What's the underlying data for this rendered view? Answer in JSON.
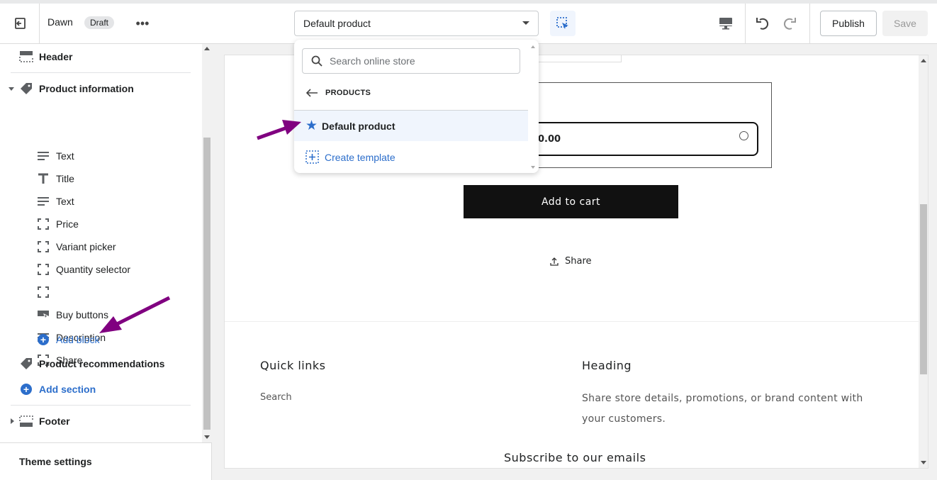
{
  "topbar": {
    "theme_name": "Dawn",
    "status_badge": "Draft",
    "template_select": "Default product",
    "publish_label": "Publish",
    "save_label": "Save"
  },
  "dropdown": {
    "search_placeholder": "Search online store",
    "back_label": "PRODUCTS",
    "selected_item": "Default product",
    "create_label": "Create template"
  },
  "sidebar": {
    "header": "Header",
    "product_information": "Product information",
    "blocks": [
      {
        "label": "Text",
        "icon": "text-icon"
      },
      {
        "label": "Title",
        "icon": "title-icon"
      },
      {
        "label": "Text",
        "icon": "text-icon"
      },
      {
        "label": "Price",
        "icon": "block-icon"
      },
      {
        "label": "Variant picker",
        "icon": "block-icon"
      },
      {
        "label": "Quantity selector",
        "icon": "block-icon"
      },
      {
        "label": "",
        "icon": "block-icon"
      },
      {
        "label": "Buy buttons",
        "icon": "buy-buttons-icon"
      },
      {
        "label": "Description",
        "icon": "text-icon"
      },
      {
        "label": "Share",
        "icon": "block-icon"
      }
    ],
    "add_block": "Add block",
    "product_recommendations": "Product recommendations",
    "add_section": "Add section",
    "footer": "Footer",
    "theme_settings": "Theme settings"
  },
  "preview": {
    "price_partial": "0.00",
    "add_to_cart": "Add to cart",
    "share": "Share",
    "quick_links": "Quick links",
    "search_link": "Search",
    "heading": "Heading",
    "heading_text": "Share store details, promotions, or brand content with your customers.",
    "subscribe": "Subscribe to our emails"
  },
  "colors": {
    "accent": "#2c6ecb",
    "annotation_arrow": "#800080"
  }
}
